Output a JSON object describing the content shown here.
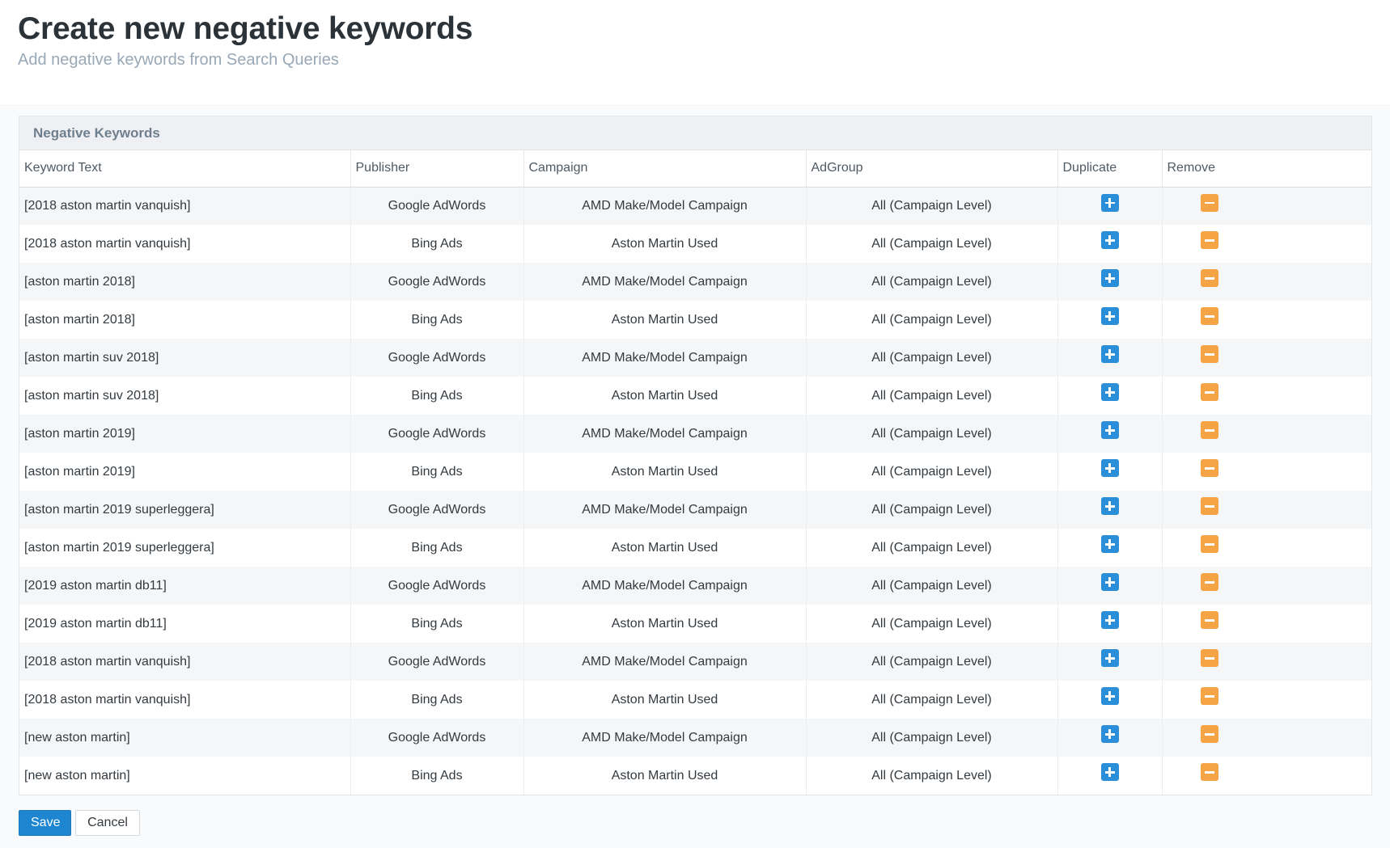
{
  "header": {
    "title": "Create new negative keywords",
    "subtitle": "Add negative keywords from Search Queries"
  },
  "panel": {
    "title": "Negative Keywords"
  },
  "table": {
    "columns": [
      "Keyword Text",
      "Publisher",
      "Campaign",
      "AdGroup",
      "Duplicate",
      "Remove"
    ],
    "rows": [
      {
        "keyword": "[2018 aston martin vanquish]",
        "publisher": "Google AdWords",
        "campaign": "AMD Make/Model Campaign",
        "adgroup": "All (Campaign Level)"
      },
      {
        "keyword": "[2018 aston martin vanquish]",
        "publisher": "Bing Ads",
        "campaign": "Aston Martin Used",
        "adgroup": "All (Campaign Level)"
      },
      {
        "keyword": "[aston martin 2018]",
        "publisher": "Google AdWords",
        "campaign": "AMD Make/Model Campaign",
        "adgroup": "All (Campaign Level)"
      },
      {
        "keyword": "[aston martin 2018]",
        "publisher": "Bing Ads",
        "campaign": "Aston Martin Used",
        "adgroup": "All (Campaign Level)"
      },
      {
        "keyword": "[aston martin suv 2018]",
        "publisher": "Google AdWords",
        "campaign": "AMD Make/Model Campaign",
        "adgroup": "All (Campaign Level)"
      },
      {
        "keyword": "[aston martin suv 2018]",
        "publisher": "Bing Ads",
        "campaign": "Aston Martin Used",
        "adgroup": "All (Campaign Level)"
      },
      {
        "keyword": "[aston martin 2019]",
        "publisher": "Google AdWords",
        "campaign": "AMD Make/Model Campaign",
        "adgroup": "All (Campaign Level)"
      },
      {
        "keyword": "[aston martin 2019]",
        "publisher": "Bing Ads",
        "campaign": "Aston Martin Used",
        "adgroup": "All (Campaign Level)"
      },
      {
        "keyword": "[aston martin 2019 superleggera]",
        "publisher": "Google AdWords",
        "campaign": "AMD Make/Model Campaign",
        "adgroup": "All (Campaign Level)"
      },
      {
        "keyword": "[aston martin 2019 superleggera]",
        "publisher": "Bing Ads",
        "campaign": "Aston Martin Used",
        "adgroup": "All (Campaign Level)"
      },
      {
        "keyword": "[2019 aston martin db11]",
        "publisher": "Google AdWords",
        "campaign": "AMD Make/Model Campaign",
        "adgroup": "All (Campaign Level)"
      },
      {
        "keyword": "[2019 aston martin db11]",
        "publisher": "Bing Ads",
        "campaign": "Aston Martin Used",
        "adgroup": "All (Campaign Level)"
      },
      {
        "keyword": "[2018 aston martin vanquish]",
        "publisher": "Google AdWords",
        "campaign": "AMD Make/Model Campaign",
        "adgroup": "All (Campaign Level)"
      },
      {
        "keyword": "[2018 aston martin vanquish]",
        "publisher": "Bing Ads",
        "campaign": "Aston Martin Used",
        "adgroup": "All (Campaign Level)"
      },
      {
        "keyword": "[new aston martin]",
        "publisher": "Google AdWords",
        "campaign": "AMD Make/Model Campaign",
        "adgroup": "All (Campaign Level)"
      },
      {
        "keyword": "[new aston martin]",
        "publisher": "Bing Ads",
        "campaign": "Aston Martin Used",
        "adgroup": "All (Campaign Level)"
      }
    ],
    "duplicate_icon": "plus-square-icon",
    "remove_icon": "minus-square-icon"
  },
  "actions": {
    "save_label": "Save",
    "cancel_label": "Cancel"
  },
  "colors": {
    "primary": "#1e86d0",
    "duplicate": "#2a8fd8",
    "remove": "#f5a445"
  }
}
